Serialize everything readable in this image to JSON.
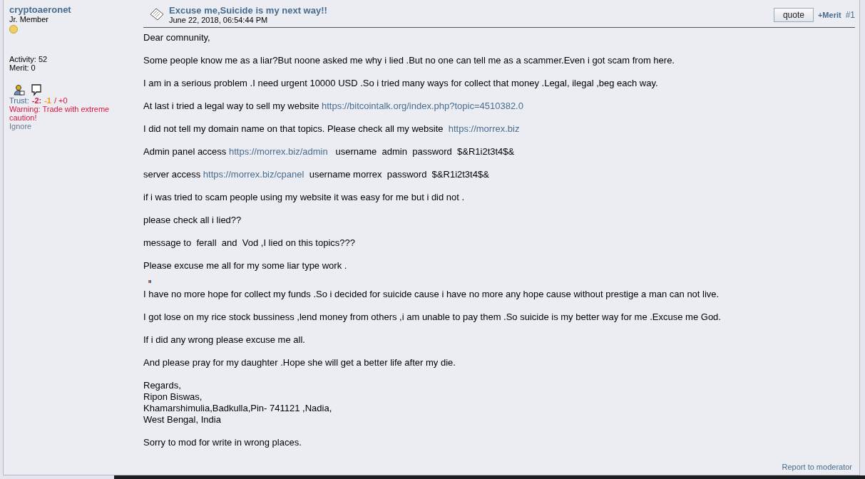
{
  "poster": {
    "name": "cryptoaeronet",
    "rank": "Jr. Member",
    "activity": "Activity: 52",
    "merit": "Merit: 0",
    "trust": {
      "label": "Trust:",
      "parts": [
        {
          "text": "-2:",
          "color": "#dc143c",
          "bold": true
        },
        {
          "text": "-1",
          "color": "#ff9900",
          "bold": true
        },
        {
          "text": "/ +0",
          "color": "#dc143c",
          "bold": false
        }
      ]
    },
    "warning": "Warning: Trade with extreme caution!",
    "ignore": "Ignore"
  },
  "post": {
    "title": "Excuse me,Suicide is my next way!!",
    "date": "June 22, 2018, 06:54:44 PM",
    "quote_button": "quote",
    "merit_link": "+Merit",
    "number": "#1",
    "paragraphs": [
      {
        "kind": "text",
        "segments": [
          {
            "kind": "text",
            "text": "Dear comnunity,"
          }
        ]
      },
      {
        "kind": "text",
        "segments": [
          {
            "kind": "text",
            "text": "Some people know me as a liar?But noone asked me why i lied .But no one can tell me as a scammer.Even i got scam from here."
          }
        ]
      },
      {
        "kind": "text",
        "segments": [
          {
            "kind": "text",
            "text": "I am in a serious problem .I need urgent 10000 USD .So i tried many ways for collect that money .Legal, ilegal ,beg each way."
          }
        ]
      },
      {
        "kind": "text",
        "segments": [
          {
            "kind": "text",
            "text": "At last i tried a legal way to sell my website "
          },
          {
            "kind": "link",
            "text": "https://bitcointalk.org/index.php?topic=4510382.0"
          }
        ]
      },
      {
        "kind": "text",
        "segments": [
          {
            "kind": "text",
            "text": "I did not tell my domain name on that topics. Please check all my website  "
          },
          {
            "kind": "link",
            "text": "https://morrex.biz"
          }
        ]
      },
      {
        "kind": "text",
        "segments": [
          {
            "kind": "text",
            "text": "Admin panel access "
          },
          {
            "kind": "link",
            "text": "https://morrex.biz/admin"
          },
          {
            "kind": "text",
            "text": "   username  admin  password  $&R1i2t3t4$&"
          }
        ]
      },
      {
        "kind": "text",
        "segments": [
          {
            "kind": "text",
            "text": "server access "
          },
          {
            "kind": "link",
            "text": "https://morrex.biz/cpanel"
          },
          {
            "kind": "text",
            "text": "  username morrex  password  $&R1i2t3t4$&"
          }
        ]
      },
      {
        "kind": "text",
        "segments": [
          {
            "kind": "text",
            "text": "if i was tried to scam people using my website it was easy for me but i did not ."
          }
        ]
      },
      {
        "kind": "text",
        "segments": [
          {
            "kind": "text",
            "text": "please check all i lied??"
          }
        ]
      },
      {
        "kind": "text",
        "segments": [
          {
            "kind": "text",
            "text": "message to  ferall  and  Vod ,I lied on this topics???"
          }
        ]
      },
      {
        "kind": "text",
        "segments": [
          {
            "kind": "text",
            "text": "Please excuse me all for my some liar type work ."
          }
        ]
      },
      {
        "kind": "image"
      },
      {
        "kind": "text",
        "segments": [
          {
            "kind": "text",
            "text": "I have no more hope for collect my funds .So i decided for suicide cause i have no more any hope cause without prestige a man can not live."
          }
        ]
      },
      {
        "kind": "text",
        "segments": [
          {
            "kind": "text",
            "text": "I got lose on my rice stock bussiness ,lend money from others ,i am unable to pay them .So suicide is my better way for me .Excuse me God."
          }
        ]
      },
      {
        "kind": "text",
        "segments": [
          {
            "kind": "text",
            "text": "If i did any wrong please excuse me all."
          }
        ]
      },
      {
        "kind": "text",
        "segments": [
          {
            "kind": "text",
            "text": "And please pray for my daughter .Hope she will get a better life after my die."
          }
        ]
      },
      {
        "kind": "lines",
        "lines": [
          "Regards,",
          "Ripon Biswas,",
          "Khamarshimulia,Badkulla,Pin- 741121 ,Nadia,",
          "West Bengal, India"
        ]
      },
      {
        "kind": "text",
        "segments": [
          {
            "kind": "text",
            "text": "Sorry to mod for write in wrong places."
          }
        ]
      }
    ],
    "report_link": "Report to moderator"
  }
}
